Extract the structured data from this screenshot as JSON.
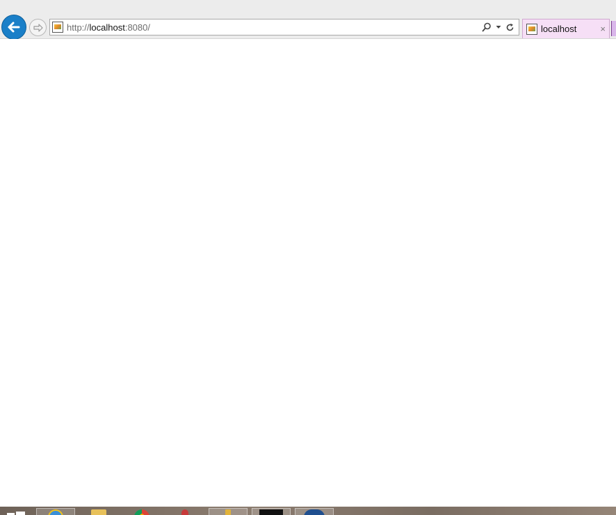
{
  "browser": {
    "address_bar": {
      "url_scheme": "http://",
      "url_host": "localhost",
      "url_rest": ":8080/"
    },
    "tabs": [
      {
        "label": "localhost",
        "close_glyph": "×"
      }
    ],
    "icons": {
      "back": "back-arrow-icon",
      "forward": "forward-arrow-icon",
      "search": "search-icon",
      "dropdown": "dropdown-icon",
      "refresh": "refresh-icon",
      "favicon": "page-favicon-icon"
    },
    "colors": {
      "back_button": "#1a7fc8",
      "active_tab": "#f6dff6"
    }
  },
  "taskbar": {
    "items": [
      {
        "icon": "internet-explorer-icon",
        "color": "#3a8fd8"
      },
      {
        "icon": "file-explorer-icon",
        "color": "#e8c15a"
      },
      {
        "icon": "chrome-icon",
        "color": "#4caf50"
      },
      {
        "icon": "app-icon",
        "color": "#d33"
      },
      {
        "icon": "tools-icon",
        "color": "#e2b33a"
      },
      {
        "icon": "terminal-icon",
        "color": "#111111"
      },
      {
        "icon": "editor-icon",
        "color": "#1f4f8f"
      }
    ]
  }
}
